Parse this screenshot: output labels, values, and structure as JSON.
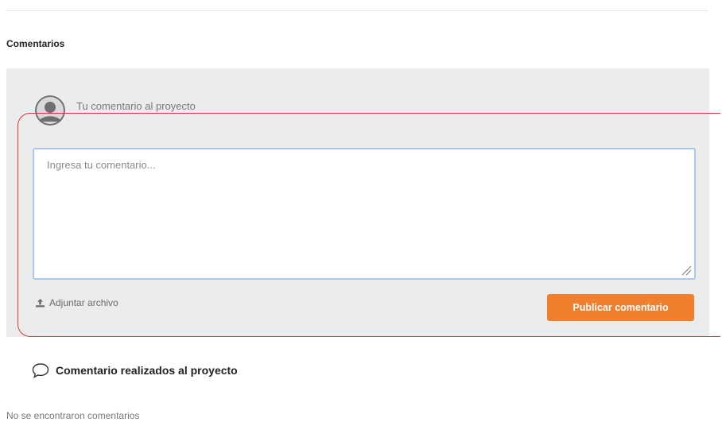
{
  "section": {
    "title": "Comentarios"
  },
  "comment_form": {
    "user_label": "Tu comentario al proyecto",
    "textarea_placeholder": "Ingresa tu comentario...",
    "attach_label": "Adjuntar archivo",
    "publish_label": "Publicar comentario"
  },
  "comments_list": {
    "heading": "Comentario realizados al proyecto",
    "empty_message": "No se encontraron comentarios"
  },
  "icons": {
    "avatar": "user-avatar-icon",
    "attach": "upload-icon",
    "comments": "speech-bubble-icon"
  },
  "colors": {
    "panel_bg": "#ececec",
    "publish_button": "#f0802e",
    "textarea_border": "#a9c9ec",
    "highlight": "#d23a3a"
  }
}
